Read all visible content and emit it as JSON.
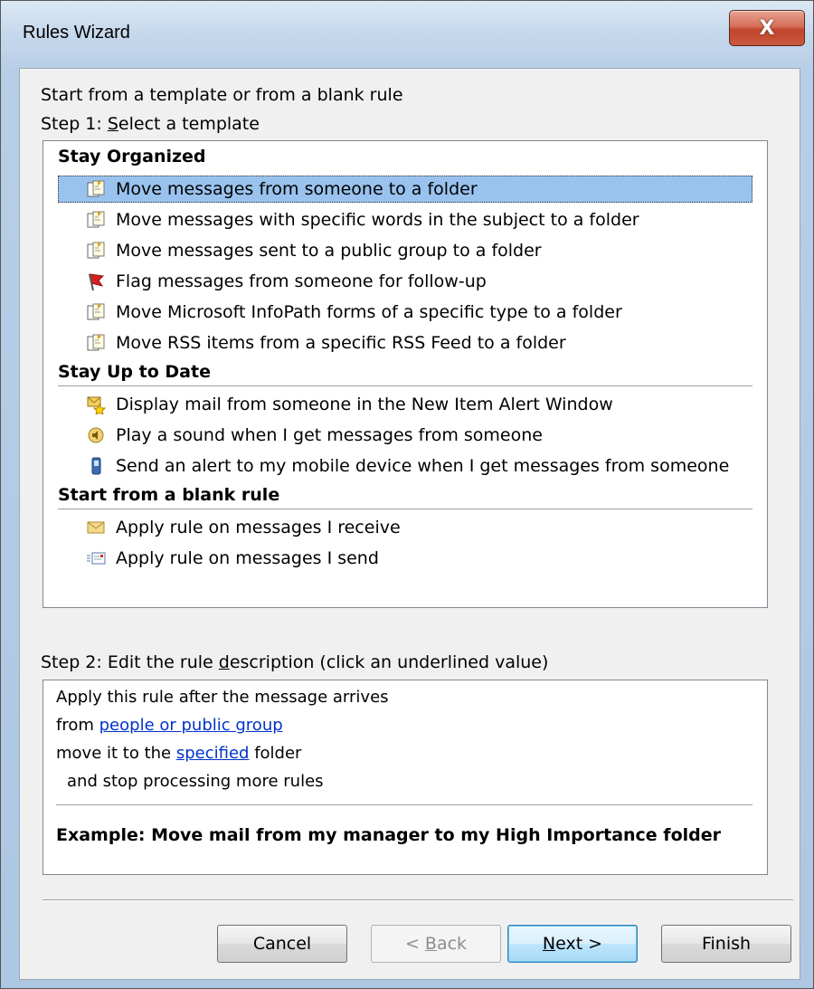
{
  "window": {
    "title": "Rules Wizard",
    "close_glyph": "X"
  },
  "step1": {
    "intro": "Start from a template or from a blank rule",
    "label_prefix": "Step 1: ",
    "label_accel": "S",
    "label_rest": "elect a template"
  },
  "groups": [
    {
      "heading": "Stay Organized"
    },
    {
      "heading": "Stay Up to Date"
    },
    {
      "heading": "Start from a blank rule"
    }
  ],
  "items": [
    {
      "label": "Move messages from someone to a folder",
      "icon": "move-to-folder-icon"
    },
    {
      "label": "Move messages with specific words in the subject to a folder",
      "icon": "move-to-folder-icon"
    },
    {
      "label": "Move messages sent to a public group to a folder",
      "icon": "move-to-folder-icon"
    },
    {
      "label": "Flag messages from someone for follow-up",
      "icon": "red-flag-icon"
    },
    {
      "label": "Move Microsoft InfoPath forms of a specific type to a folder",
      "icon": "move-to-folder-icon"
    },
    {
      "label": "Move RSS items from a specific RSS Feed to a folder",
      "icon": "move-to-folder-icon"
    },
    {
      "label": "Display mail from someone in the New Item Alert Window",
      "icon": "alert-window-icon"
    },
    {
      "label": "Play a sound when I get messages from someone",
      "icon": "speaker-icon"
    },
    {
      "label": "Send an alert to my mobile device when I get messages from someone",
      "icon": "mobile-phone-icon"
    },
    {
      "label": "Apply rule on messages I receive",
      "icon": "envelope-icon"
    },
    {
      "label": "Apply rule on messages I send",
      "icon": "sent-mail-icon"
    }
  ],
  "step2": {
    "label_prefix": "Step 2: Edit the rule ",
    "label_accel": "d",
    "label_rest": "escription (click an underlined value)"
  },
  "description": {
    "line1": "Apply this rule after the message arrives",
    "line2_prefix": "from ",
    "line2_link": "people or public group",
    "line3_prefix": "move it to the ",
    "line3_link": "specified",
    "line3_suffix": " folder",
    "line4": "and stop processing more rules",
    "example": "Example: Move mail from my manager to my High Importance folder"
  },
  "buttons": {
    "cancel": "Cancel",
    "back_prefix": "< ",
    "back_accel": "B",
    "back_rest": "ack",
    "next_accel": "N",
    "next_rest": "ext >",
    "finish": "Finish"
  },
  "colors": {
    "selection": "#99c3ee",
    "link": "#0033cc",
    "close": "#c7462d"
  }
}
